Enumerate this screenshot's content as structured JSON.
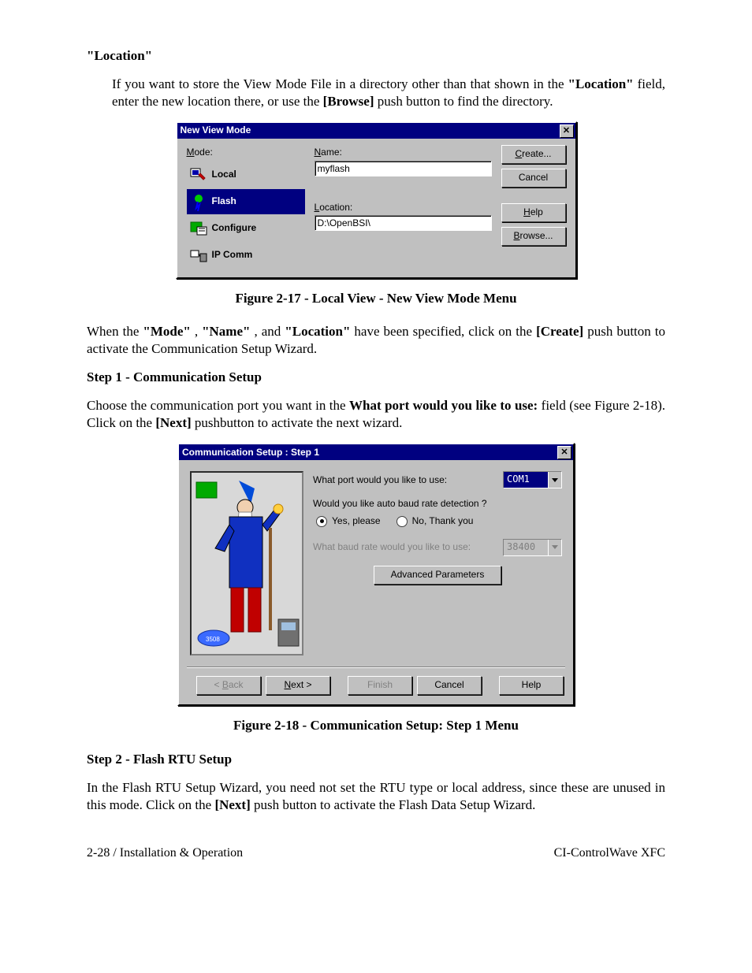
{
  "section": {
    "location_heading": "\"Location\"",
    "location_para_1": "If you want to store the View Mode File in a directory other than that shown in the ",
    "location_bold": "\"Location\"",
    "location_para_2": " field, enter the new location there, or use the ",
    "browse_bold": "[Browse]",
    "location_para_3": " push button to find the directory."
  },
  "dlg1": {
    "title": "New View Mode",
    "mode_label": "Mode:",
    "name_label": "Name:",
    "name_value": "myflash",
    "location_label": "Location:",
    "location_value": "D:\\OpenBSI\\",
    "btn_create": "Create...",
    "btn_cancel": "Cancel",
    "btn_help": "Help",
    "btn_browse": "Browse...",
    "modes": {
      "local": "Local",
      "flash": "Flash",
      "configure": "Configure",
      "ipcomm": "IP Comm"
    }
  },
  "fig1_caption": "Figure 2-17 - Local View - New View Mode Menu",
  "mid": {
    "para1_a": "When the ",
    "mode_b": "\"Mode\"",
    "sep1": ", ",
    "name_b": "\"Name\"",
    "sep2": ", and ",
    "loc_b": "\"Location\"",
    "para1_b": " have been specified, click on the ",
    "create_b": "[Create]",
    "para1_c": " push button to activate the Communication Setup Wizard.",
    "step1_h": "Step 1 - Communication Setup",
    "step1_a": "Choose the communication port you want in the ",
    "step1_bold": "What port would you like to use:",
    "step1_b": " field (see Figure 2-18). Click on the ",
    "next_b": "[Next]",
    "step1_c": " pushbutton to activate the next wizard."
  },
  "dlg2": {
    "title": "Communication Setup : Step 1",
    "q_port": "What port would you like to use:",
    "port_value": "COM1",
    "q_auto": "Would you like auto baud rate detection ?",
    "opt_yes": "Yes, please",
    "opt_no": "No, Thank you",
    "q_baud": "What baud rate would you like to use:",
    "baud_value": "38400",
    "adv": "Advanced Parameters",
    "btn_back": "< Back",
    "btn_next": "Next >",
    "btn_finish": "Finish",
    "btn_cancel": "Cancel",
    "btn_help": "Help"
  },
  "fig2_caption": "Figure 2-18 - Communication Setup: Step 1 Menu",
  "step2": {
    "heading": "Step 2 - Flash RTU Setup",
    "para_a": "In the Flash RTU Setup Wizard, you need not set the RTU type or local address, since these are unused in this mode. Click on the ",
    "next_b": "[Next]",
    "para_b": " push button to activate the Flash Data Setup Wizard."
  },
  "footer": {
    "left": "2-28 / Installation & Operation",
    "right": "CI-ControlWave XFC"
  }
}
